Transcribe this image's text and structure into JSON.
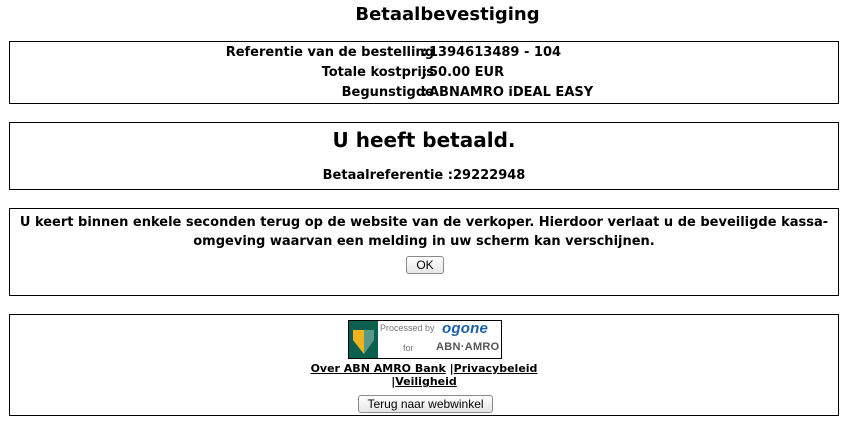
{
  "page": {
    "title": "Betaalbevestiging"
  },
  "order": {
    "reference_label": "Referentie van de bestelling",
    "reference_value": "1394613489 - 104",
    "total_label": "Totale kostprijs",
    "total_value": "50.00 EUR",
    "beneficiary_label": "Begunstigde",
    "beneficiary_value": "ABNAMRO iDEAL EASY",
    "separator": ":"
  },
  "result": {
    "heading": "U heeft betaald.",
    "payment_reference": "Betaalreferentie :29222948"
  },
  "info": {
    "message": "U keert binnen enkele seconden terug op de website van de verkoper. Hierdoor verlaat u de beveiligde kassa-omgeving waarvan een melding in uw scherm kan verschijnen.",
    "ok_label": "OK"
  },
  "footer": {
    "logo": {
      "processed_by": "Processed by",
      "brand": "ogone",
      "for": "for",
      "bank": "ABN·AMRO",
      "shield_colors": [
        "#0b5f4f",
        "#f2b21b",
        "#7fb8a6"
      ],
      "brand_color": "#1b5fa6"
    },
    "links": {
      "about": "Over ABN AMRO Bank",
      "separator": "|",
      "privacy": "Privacybeleid",
      "security": "Veiligheid"
    },
    "back_label": "Terug naar webwinkel"
  }
}
